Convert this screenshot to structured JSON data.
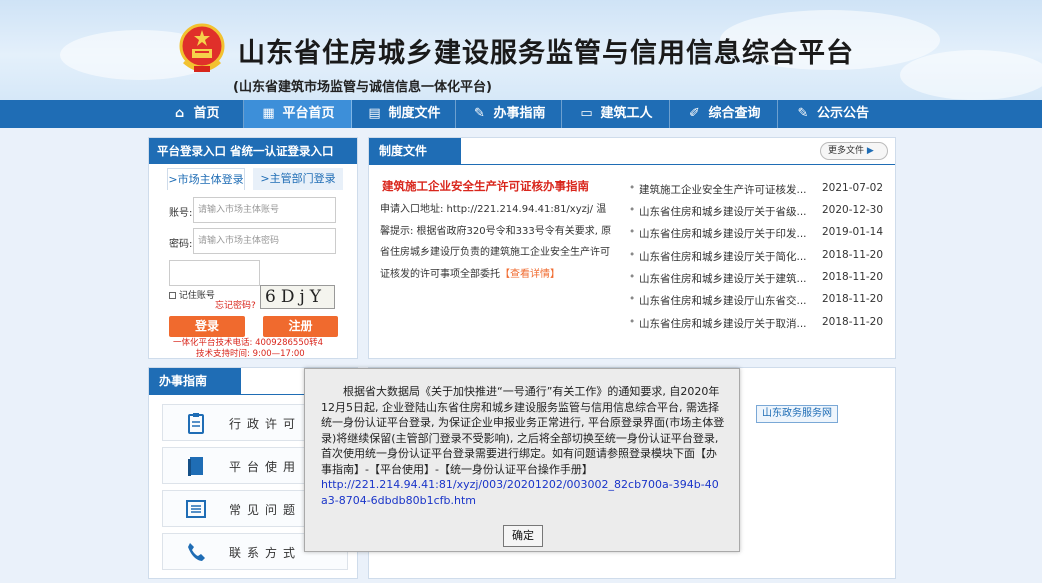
{
  "header": {
    "title": "山东省住房城乡建设服务监管与信用信息综合平台",
    "subtitle": "(山东省建筑市场监管与诚信信息一体化平台)"
  },
  "nav": {
    "items": [
      {
        "label": "首页",
        "icon": "home-icon"
      },
      {
        "label": "平台首页",
        "icon": "grid-icon"
      },
      {
        "label": "制度文件",
        "icon": "document-icon"
      },
      {
        "label": "办事指南",
        "icon": "guide-icon"
      },
      {
        "label": "建筑工人",
        "icon": "monitor-icon"
      },
      {
        "label": "综合查询",
        "icon": "edit-icon"
      },
      {
        "label": "公示公告",
        "icon": "notice-icon"
      }
    ]
  },
  "login": {
    "header": "平台登录入口 省统一认证登录入口",
    "tab_market": ">市场主体登录",
    "tab_dept": ">主管部门登录",
    "account_label": "账号:",
    "account_placeholder": "请输入市场主体账号",
    "password_label": "密码:",
    "password_placeholder": "请输入市场主体密码",
    "remember_label": "记住账号",
    "forgot_label": "忘记密码?",
    "captcha": "6DjY",
    "login_button": "登录",
    "register_button": "注册",
    "support_phone": "一体化平台技术电话: 4009286550转4",
    "support_hours": "技术支持时间: 9:00—17:00"
  },
  "policy": {
    "header": "制度文件",
    "more": "更多文件",
    "feature_title": "建筑施工企业安全生产许可证核办事指南",
    "feature_body": "申请入口地址: http://221.214.94.41:81/xyzj/ 温馨提示: 根据省政府320号令和333号令有关要求, 原省住房城乡建设厅负责的建筑施工企业安全生产许可证核发的许可事项全部委托",
    "feature_more": "【查看详情】",
    "list": [
      {
        "title": "建筑施工企业安全生产许可证核发...",
        "date": "2021-07-02"
      },
      {
        "title": "山东省住房和城乡建设厅关于省级...",
        "date": "2020-12-30"
      },
      {
        "title": "山东省住房和城乡建设厅关于印发...",
        "date": "2019-01-14"
      },
      {
        "title": "山东省住房和城乡建设厅关于简化...",
        "date": "2018-11-20"
      },
      {
        "title": "山东省住房和城乡建设厅关于建筑...",
        "date": "2018-11-20"
      },
      {
        "title": "山东省住房和城乡建设厅山东省交...",
        "date": "2018-11-20"
      },
      {
        "title": "山东省住房和城乡建设厅关于取消...",
        "date": "2018-11-20"
      }
    ]
  },
  "guide": {
    "header": "办事指南",
    "items": [
      {
        "label": "行政许可",
        "icon": "clipboard-icon"
      },
      {
        "label": "平台使用",
        "icon": "book-icon"
      },
      {
        "label": "常见问题",
        "icon": "list-icon"
      },
      {
        "label": "联系方式",
        "icon": "phone-icon"
      }
    ]
  },
  "links": {
    "gov_service": "山东政务服务网"
  },
  "modal": {
    "text": "根据省大数据局《关于加快推进“一号通行”有关工作》的通知要求, 自2020年12月5日起, 企业登陆山东省住房和城乡建设服务监管与信用信息综合平台, 需选择统一身份认证平台登录, 为保证企业申报业务正常进行, 平台原登录界面(市场主体登录)将继续保留(主管部门登录不受影响), 之后将全部切换至统一身份认证平台登录, 首次使用统一身份认证平台登录需要进行绑定。如有问题请参照登录模块下面【办事指南】-【平台使用】-【统一身份认证平台操作手册】",
    "link": "http://221.214.94.41:81/xyzj/003/20201202/003002_82cb700a-394b-40a3-8704-6dbdb80b1cfb.htm",
    "ok": "确定"
  },
  "colors": {
    "nav_blue": "#1f6db5",
    "accent_orange": "#f06a2e",
    "title_red": "#d9261c"
  }
}
